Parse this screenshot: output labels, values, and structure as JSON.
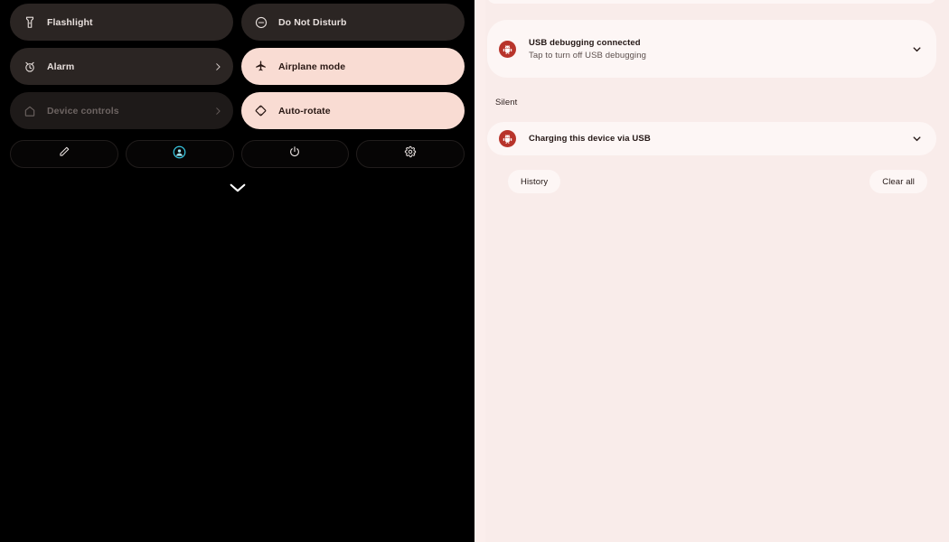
{
  "quick_settings": {
    "panel_name": "Quick Settings",
    "background_color": "#000000",
    "tile_on_color": "#f9dcd3",
    "tile_off_color": "#2b2523",
    "tile_disabled_color": "#1e1a19",
    "tiles": [
      {
        "label": "Flashlight",
        "icon": "flashlight-icon",
        "state": "off",
        "chevron": false
      },
      {
        "label": "Do Not Disturb",
        "icon": "dnd-icon",
        "state": "off",
        "chevron": false
      },
      {
        "label": "Alarm",
        "icon": "alarm-icon",
        "state": "off",
        "chevron": true
      },
      {
        "label": "Airplane mode",
        "icon": "airplane-icon",
        "state": "on",
        "chevron": false
      },
      {
        "label": "Device controls",
        "icon": "home-icon",
        "state": "disabled",
        "chevron": true
      },
      {
        "label": "Auto-rotate",
        "icon": "autorotate-icon",
        "state": "on",
        "chevron": false
      }
    ],
    "footer_buttons": [
      {
        "name": "edit-tiles-button",
        "icon": "pencil-icon"
      },
      {
        "name": "user-switch-button",
        "icon": "user-avatar-icon",
        "color": "#37c6e0"
      },
      {
        "name": "power-menu-button",
        "icon": "power-icon"
      },
      {
        "name": "settings-button",
        "icon": "gear-icon"
      }
    ],
    "expand_chevron_icon": "chevron-down-icon"
  },
  "notification_shade": {
    "panel_name": "Notification shade",
    "background_color": "#f9ecea",
    "card_color": "#fdf6f5",
    "icon_badge_color": "#b8342b",
    "section_header": "Silent",
    "notifications": [
      {
        "id": "clipped-top",
        "title": "",
        "subtitle": "",
        "icon": "",
        "expand_icon": "",
        "clipped": true
      },
      {
        "id": "usb-debugging",
        "title": "USB debugging connected",
        "subtitle": "Tap to turn off USB debugging",
        "icon": "android-debug-bug-icon",
        "expand_icon": "chevron-down-icon",
        "clipped": false
      },
      {
        "id": "charging-usb",
        "title": "Charging this device via USB",
        "subtitle": "",
        "icon": "android-debug-bug-icon",
        "expand_icon": "chevron-down-icon",
        "clipped": false
      }
    ],
    "actions": {
      "history_label": "History",
      "clear_all_label": "Clear all"
    }
  }
}
